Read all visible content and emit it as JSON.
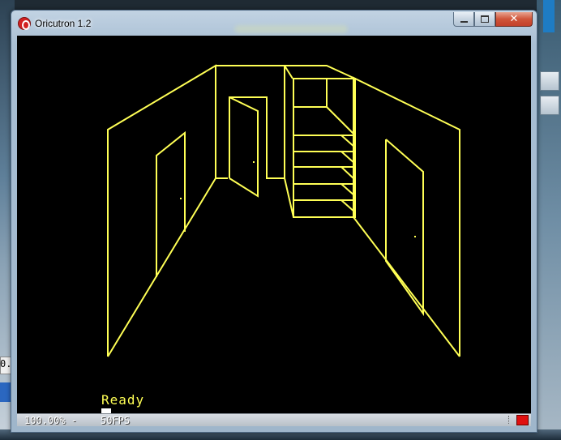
{
  "window": {
    "title": "Oricutron 1.2",
    "close_glyph": "✕"
  },
  "screen": {
    "ready_text": "Ready",
    "foreground_color": "#ffff55",
    "background_color": "#000000"
  },
  "status_bar": {
    "speed": "100.00% -",
    "fps": "50FPS",
    "indicator_color": "#e01010"
  },
  "desktop": {
    "left_fragment_text": "0."
  },
  "icons": {
    "app": "oricutron-icon",
    "minimize": "minimize-icon",
    "maximize": "maximize-icon",
    "close": "close-icon"
  }
}
